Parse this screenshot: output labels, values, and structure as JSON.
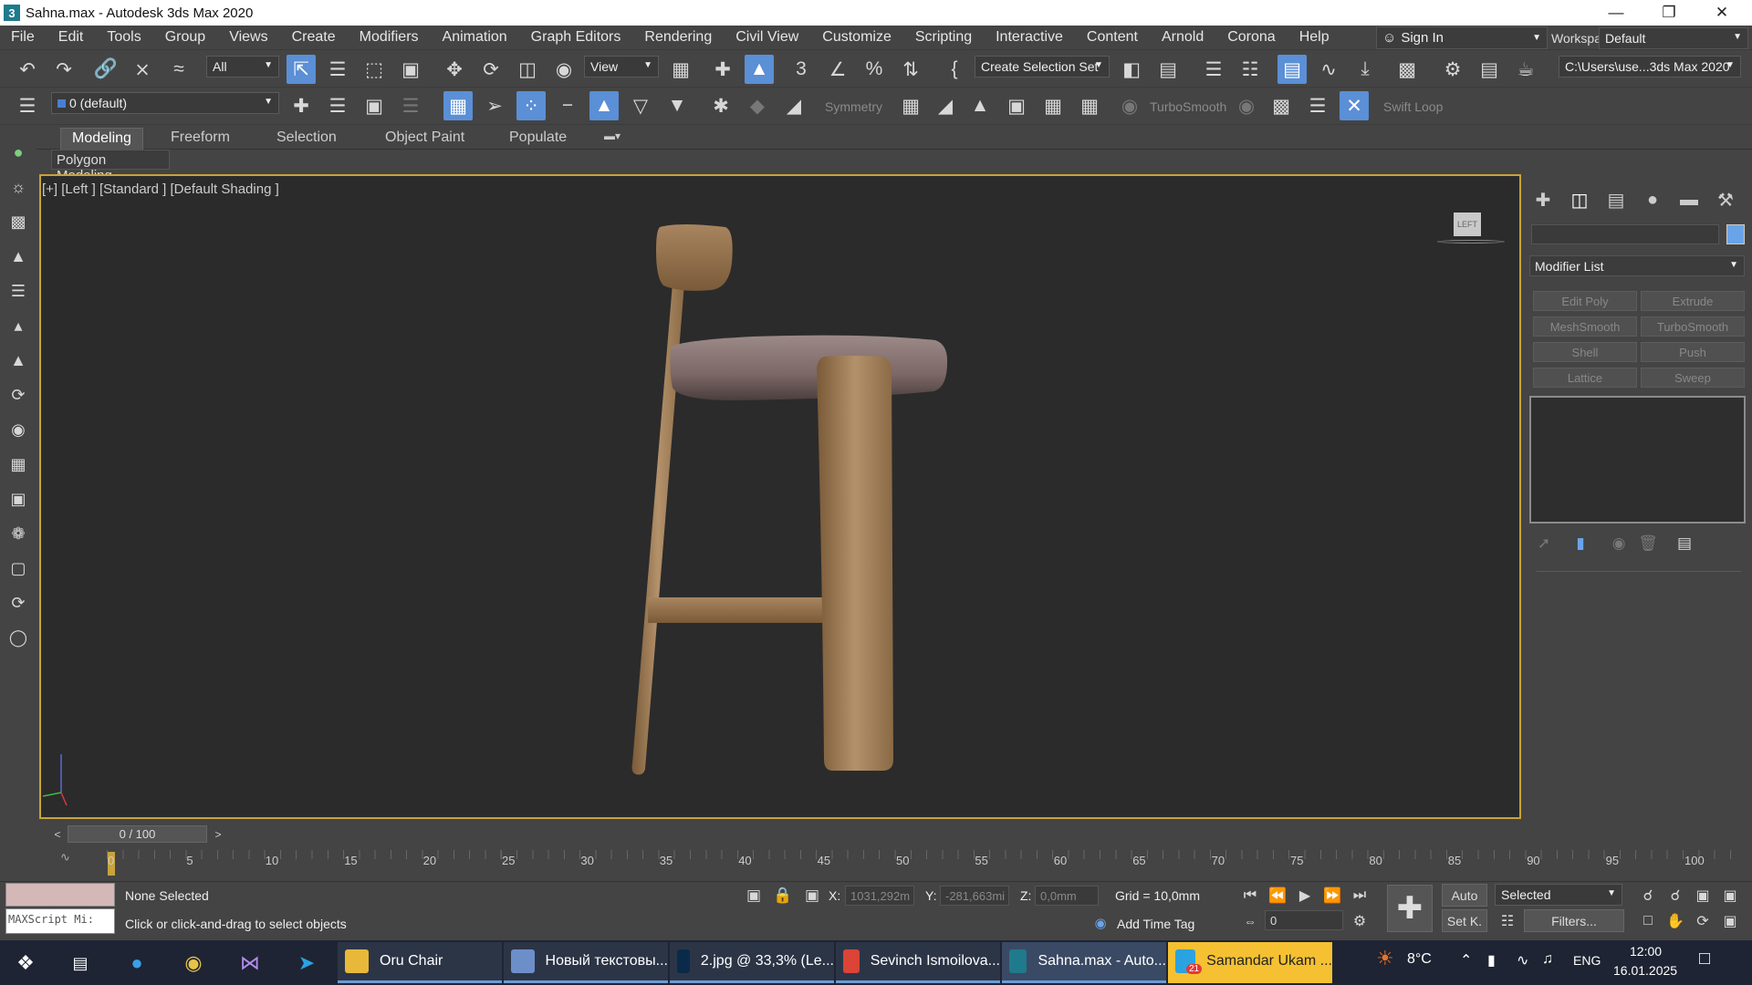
{
  "window": {
    "title": "Sahna.max - Autodesk 3ds Max 2020",
    "app_icon": "3"
  },
  "menu": [
    "File",
    "Edit",
    "Tools",
    "Group",
    "Views",
    "Create",
    "Modifiers",
    "Animation",
    "Graph Editors",
    "Rendering",
    "Civil View",
    "Customize",
    "Scripting",
    "Interactive",
    "Content",
    "Arnold",
    "Corona",
    "Help"
  ],
  "signin": {
    "label": "Sign In"
  },
  "workspaces": {
    "label": "Workspaces:",
    "value": "Default"
  },
  "toolbar": {
    "filter": "All",
    "refcoord": "View",
    "selset": "Create Selection Set",
    "path": "C:\\Users\\use...3ds Max 2020"
  },
  "toolbar2": {
    "layer": "0 (default)",
    "symmetry": "Symmetry",
    "turbosmooth": "TurboSmooth",
    "swiftloop": "Swift Loop"
  },
  "ribbon": {
    "tabs": [
      "Modeling",
      "Freeform",
      "Selection",
      "Object Paint",
      "Populate"
    ],
    "sub": "Polygon Modeling"
  },
  "viewport": {
    "label": "[+] [Left ] [Standard ] [Default Shading ]",
    "cube": "LEFT"
  },
  "command_panel": {
    "modifier_list": "Modifier List",
    "buttons": [
      "Edit Poly",
      "Extrude",
      "MeshSmooth",
      "TurboSmooth",
      "Shell",
      "Push",
      "Lattice",
      "Sweep"
    ]
  },
  "timeline": {
    "slider": "0 / 100",
    "ticks": [
      "0",
      "5",
      "10",
      "15",
      "20",
      "25",
      "30",
      "35",
      "40",
      "45",
      "50",
      "55",
      "60",
      "65",
      "70",
      "75",
      "80",
      "85",
      "90",
      "95",
      "100"
    ]
  },
  "status": {
    "maxscript": "MAXScript Mi:",
    "selection": "None Selected",
    "prompt": "Click or click-and-drag to select objects",
    "x_label": "X:",
    "x": "1031,292m",
    "y_label": "Y:",
    "y": "-281,663mi",
    "z_label": "Z:",
    "z": "0,0mm",
    "grid": "Grid = 10,0mm",
    "add_time_tag": "Add Time Tag",
    "auto": "Auto",
    "selected": "Selected",
    "frame": "0",
    "setk": "Set K.",
    "filters": "Filters..."
  },
  "taskbar": {
    "tasks": [
      {
        "label": "Oru Chair",
        "color": "#e8b83a",
        "icon": "folder-icon"
      },
      {
        "label": "Новый текстовы...",
        "color": "#6d8fc9",
        "icon": "notepad-icon"
      },
      {
        "label": "2.jpg @ 33,3% (Le...",
        "color": "#0a2a4a",
        "icon": "photoshop-icon"
      },
      {
        "label": "Sevinch Ismoilova...",
        "color": "#db4437",
        "icon": "chrome-icon"
      },
      {
        "label": "Sahna.max - Auto...",
        "color": "#1f7a8c",
        "icon": "3dsmax-icon"
      },
      {
        "label": "Samandar Ukam ...",
        "color": "#2aa3e0",
        "icon": "telegram-icon"
      }
    ],
    "weather": "8°C",
    "lang": "ENG",
    "time": "12:00",
    "date": "16.01.2025",
    "telegram_badge": "21"
  }
}
